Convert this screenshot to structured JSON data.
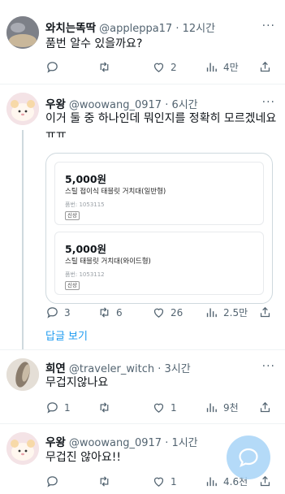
{
  "tweets": [
    {
      "name": "와치는똑딱",
      "handle": "@appleppa17 · 12시간",
      "text": "품번 알수 있을까요?",
      "reply_count": "",
      "retweet_count": "",
      "like_count": "2",
      "view_count": "4만"
    },
    {
      "name": "우왕",
      "handle": "@woowang_0917 · 6시간",
      "text": "이거 둘 중 하나인데 뭐인지를 정확히 모르겠네요ㅠㅠ",
      "reply_count": "3",
      "retweet_count": "6",
      "like_count": "26",
      "view_count": "2.5만",
      "products": [
        {
          "price": "5,000원",
          "title": "스틸 접이식 태블릿 거치대(일반형)",
          "code": "품번: 1053115",
          "badge": "신상"
        },
        {
          "price": "5,000원",
          "title": "스틸 태블릿 거치대(와이드형)",
          "code": "품번: 1053112",
          "badge": "신상"
        }
      ],
      "show_replies": "답글 보기"
    },
    {
      "name": "희연",
      "handle": "@traveler_witch · 3시간",
      "text": "무겁지않나요",
      "reply_count": "1",
      "retweet_count": "",
      "like_count": "1",
      "view_count": "9천"
    },
    {
      "name": "우왕",
      "handle": "@woowang_0917 · 1시간",
      "text": "무겁진 않아요!!",
      "reply_count": "",
      "retweet_count": "",
      "like_count": "1",
      "view_count": "4.6천"
    }
  ],
  "more_glyph": "···",
  "icons": [
    "reply-icon",
    "retweet-icon",
    "like-icon",
    "views-icon",
    "share-icon",
    "more-icon",
    "compose-icon"
  ],
  "colors": {
    "accent": "#1d9bf0",
    "secondary_text": "#536471",
    "fab": "#a8d4f7"
  }
}
